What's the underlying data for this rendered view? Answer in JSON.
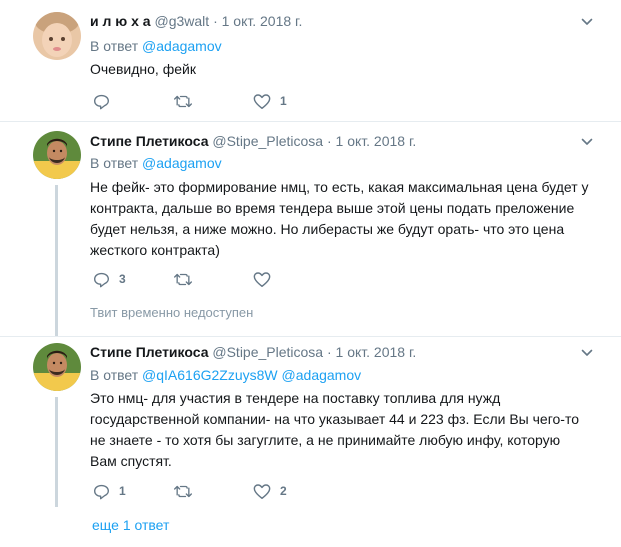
{
  "tweets": [
    {
      "name": "и л ю х а",
      "handle": "@g3walt",
      "dot": "·",
      "time": "1 окт. 2018 г.",
      "reply_prefix": "В ответ",
      "reply_to": "@adagamov",
      "reply_to2": "",
      "text": "Очевидно, фейк",
      "reply_count": "",
      "retweet_count": "",
      "like_count": "1"
    },
    {
      "name": "Стипе Плетикоса",
      "handle": "@Stipe_Pleticosa",
      "dot": "·",
      "time": "1 окт. 2018 г.",
      "reply_prefix": "В ответ",
      "reply_to": "@adagamov",
      "reply_to2": "",
      "text": "Не фейк- это формирование нмц, то есть, какая максимальная цена будет у контракта, дальше во время тендера выше этой цены подать преложение будет нельзя, а ниже можно. Но либерасты же будут орать- что это цена жесткого контракта)",
      "reply_count": "3",
      "retweet_count": "",
      "like_count": ""
    },
    {
      "name": "Стипе Плетикоса",
      "handle": "@Stipe_Pleticosa",
      "dot": "·",
      "time": "1 окт. 2018 г.",
      "reply_prefix": "В ответ",
      "reply_to": "@qIA616G2Zzuys8W",
      "reply_to2": "@adagamov",
      "text": "Это нмц- для участия в тендере на поставку топлива для нужд государственной компании- на что указывает 44 и 223 фз. Если Вы чего-то не знаете - то хотя бы загуглите, а не принимайте любую инфу, которую Вам спустят.",
      "reply_count": "1",
      "retweet_count": "",
      "like_count": "2"
    }
  ],
  "unavailable_text": "Твит временно недоступен",
  "more_replies": "еще 1 ответ",
  "icons": {
    "reply": "reply-icon",
    "retweet": "retweet-icon",
    "like": "heart-icon",
    "caret": "chevron-down-icon"
  },
  "colors": {
    "text": "#14171a",
    "secondary": "#657786",
    "link": "#1da1f2",
    "separator": "#e6ecf0",
    "thread_line": "#ccd6dd"
  }
}
